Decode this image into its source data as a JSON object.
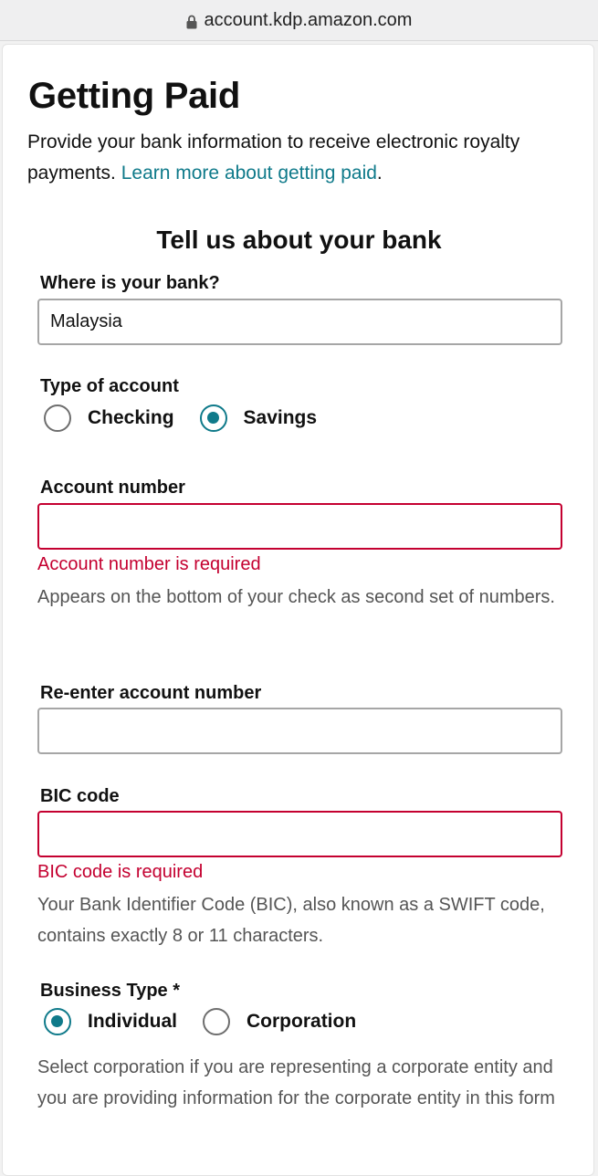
{
  "browser": {
    "url": "account.kdp.amazon.com"
  },
  "page": {
    "title": "Getting Paid",
    "intro_text": "Provide your bank information to receive electronic royalty payments. ",
    "intro_link": "Learn more about getting paid",
    "intro_end": "."
  },
  "bank_section": {
    "title": "Tell us about your bank",
    "country_label": "Where is your bank?",
    "country_value": "Malaysia",
    "account_type_label": "Type of account",
    "account_types": [
      {
        "label": "Checking",
        "selected": false
      },
      {
        "label": "Savings",
        "selected": true
      }
    ],
    "account_number_label": "Account number",
    "account_number_value": "",
    "account_number_error": "Account number is required",
    "account_number_help": "Appears on the bottom of your check as second set of numbers.",
    "reenter_label": "Re-enter account number",
    "reenter_value": "",
    "bic_label": "BIC code",
    "bic_value": "",
    "bic_error": "BIC code is required",
    "bic_help": "Your Bank Identifier Code (BIC), also known as a SWIFT code, contains exactly 8 or 11 characters.",
    "business_type_label": "Business Type *",
    "business_types": [
      {
        "label": "Individual",
        "selected": true
      },
      {
        "label": "Corporation",
        "selected": false
      }
    ],
    "business_help": "Select corporation if you are representing a corporate entity and you are providing information for the corporate entity in this form"
  },
  "colors": {
    "link": "#0f7a8a",
    "error": "#c40030",
    "radio_selected": "#0f7a8a"
  }
}
